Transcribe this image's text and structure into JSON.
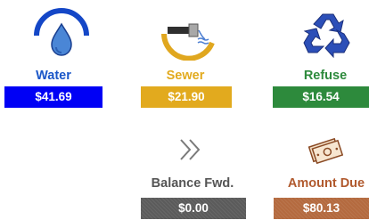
{
  "colors": {
    "water": "#1a56c8",
    "water_bar": "#0000f5",
    "sewer": "#e2aa1e",
    "refuse": "#2d8a3c",
    "balance": "#5b5b5b",
    "balance_label": "#555555",
    "amount_due": "#b46a3f",
    "amount_due_label": "#b15a2e"
  },
  "utilities": {
    "water": {
      "label": "Water",
      "amount": "$41.69",
      "icon": "water-drop-icon"
    },
    "sewer": {
      "label": "Sewer",
      "amount": "$21.90",
      "icon": "sewer-pipe-icon"
    },
    "refuse": {
      "label": "Refuse",
      "amount": "$16.54",
      "icon": "recycle-icon"
    }
  },
  "summary": {
    "balance": {
      "label": "Balance Fwd.",
      "amount": "$0.00",
      "icon": "double-chevron-right-icon"
    },
    "amount_due": {
      "label": "Amount Due",
      "amount": "$80.13",
      "icon": "money-bills-icon"
    }
  }
}
